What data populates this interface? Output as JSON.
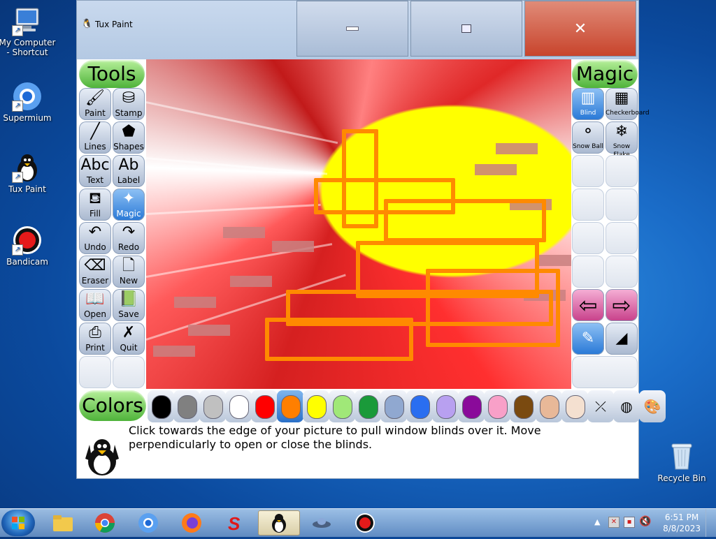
{
  "desktop": {
    "icons": [
      {
        "label": "My Computer - Shortcut"
      },
      {
        "label": "Supermium"
      },
      {
        "label": "Tux Paint"
      },
      {
        "label": "Bandicam"
      },
      {
        "label": "Recycle Bin"
      }
    ]
  },
  "window": {
    "title": "Tux Paint",
    "min_glyph": "—",
    "max_glyph": "▫",
    "close_glyph": "✕"
  },
  "tools": {
    "header": "Tools",
    "items": [
      {
        "label": "Paint",
        "icon": "brush-icon",
        "glyph": "🖌"
      },
      {
        "label": "Stamp",
        "icon": "stamp-icon",
        "glyph": "⛁"
      },
      {
        "label": "Lines",
        "icon": "lines-icon",
        "glyph": "╱"
      },
      {
        "label": "Shapes",
        "icon": "pentagon-icon",
        "glyph": "⬟"
      },
      {
        "label": "Text",
        "icon": "text-icon",
        "glyph": "Abc"
      },
      {
        "label": "Label",
        "icon": "label-icon",
        "glyph": "Ab"
      },
      {
        "label": "Fill",
        "icon": "bucket-icon",
        "glyph": "⛾"
      },
      {
        "label": "Magic",
        "icon": "magic-wand-icon",
        "glyph": "✦"
      },
      {
        "label": "Undo",
        "icon": "undo-icon",
        "glyph": "↶"
      },
      {
        "label": "Redo",
        "icon": "redo-icon",
        "glyph": "↷"
      },
      {
        "label": "Eraser",
        "icon": "eraser-icon",
        "glyph": "⌫"
      },
      {
        "label": "New",
        "icon": "new-page-icon",
        "glyph": "🗋"
      },
      {
        "label": "Open",
        "icon": "open-book-icon",
        "glyph": "📖"
      },
      {
        "label": "Save",
        "icon": "save-book-icon",
        "glyph": "📗"
      },
      {
        "label": "Print",
        "icon": "printer-icon",
        "glyph": "⎙"
      },
      {
        "label": "Quit",
        "icon": "quit-icon",
        "glyph": "✗"
      }
    ],
    "selected": "Magic"
  },
  "magic": {
    "header": "Magic",
    "items": [
      {
        "label": "Blind",
        "icon": "blind-icon",
        "glyph": "▥"
      },
      {
        "label": "Checkerboard",
        "icon": "checkerboard-icon",
        "glyph": "▦"
      },
      {
        "label": "Snow Ball",
        "icon": "snowball-icon",
        "glyph": "⚬"
      },
      {
        "label": "Snow Flake",
        "icon": "snowflake-icon",
        "glyph": "❄"
      }
    ],
    "selected": "Blind",
    "prev_glyph": "⇦",
    "next_glyph": "⇨"
  },
  "colors": {
    "header": "Colors",
    "swatches": [
      "#000000",
      "#808080",
      "#c0c0c0",
      "#ffffff",
      "#ff0000",
      "#ff7f00",
      "#ffff00",
      "#a0e878",
      "#1a9a3a",
      "#90a8d0",
      "#2a6ef0",
      "#b8a0f0",
      "#8a0a9a",
      "#f8a0c8",
      "#7a4a10",
      "#e8b898",
      "#f4e0d0"
    ],
    "selected_index": 5
  },
  "tip": "Click towards the edge of your picture to pull window blinds over it. Move perpendicularly to open or close the blinds.",
  "taskbar": {
    "time": "6:51 PM",
    "date": "8/8/2023"
  }
}
